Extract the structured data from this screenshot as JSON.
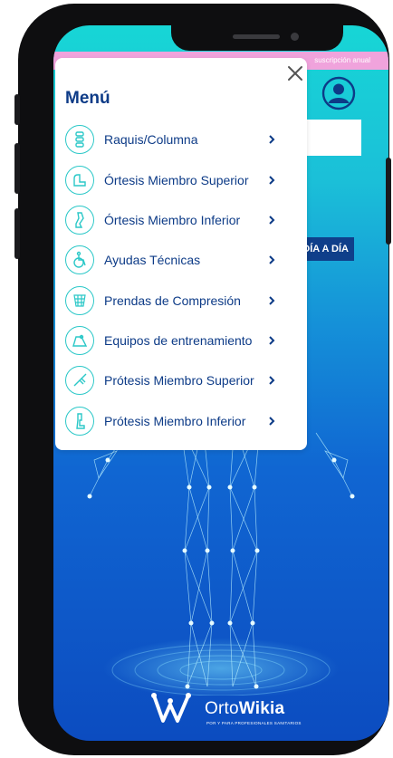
{
  "promo": {
    "text": "suscripción anual"
  },
  "day_button": {
    "label": "DÍA A DÍA"
  },
  "menu": {
    "title": "Menú",
    "items": [
      {
        "label": "Raquis/Columna",
        "icon": "spine-icon"
      },
      {
        "label": "Órtesis Miembro Superior",
        "icon": "arm-brace-icon"
      },
      {
        "label": "Órtesis Miembro Inferior",
        "icon": "leg-brace-icon"
      },
      {
        "label": "Ayudas Técnicas",
        "icon": "wheelchair-icon"
      },
      {
        "label": "Prendas de Compresión",
        "icon": "compression-garment-icon"
      },
      {
        "label": "Equipos de entrenamiento",
        "icon": "training-equipment-icon"
      },
      {
        "label": "Prótesis Miembro Superior",
        "icon": "arm-prosthesis-icon"
      },
      {
        "label": "Prótesis Miembro Inferior",
        "icon": "leg-prosthesis-icon"
      }
    ]
  },
  "logo": {
    "brand_light": "Orto",
    "brand_bold": "Wikia",
    "tagline": "POR Y PARA PROFESIONALES SANITARIOS"
  },
  "colors": {
    "accent_navy": "#0d3b87",
    "teal": "#2bc8c8",
    "promo_pink": "#f0a3dc"
  }
}
